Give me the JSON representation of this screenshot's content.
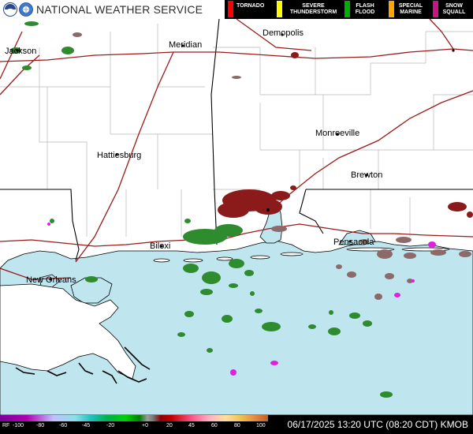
{
  "header": {
    "title": "NATIONAL WEATHER SERVICE",
    "logo_icon": "noaa-logo-icon",
    "logo2_icon": "nws-logo-icon"
  },
  "legend": {
    "items": [
      {
        "label": "TORNADO",
        "color": "#ff0000"
      },
      {
        "label": "SEVERE THUNDERSTORM",
        "color": "#ffff00"
      },
      {
        "label": "FLASH FLOOD",
        "color": "#00b000"
      },
      {
        "label": "SPECIAL MARINE",
        "color": "#ffa500"
      },
      {
        "label": "SNOW SQUALL",
        "color": "#c71585"
      }
    ]
  },
  "map": {
    "cities": [
      "Jackson",
      "Meridian",
      "Demopolis",
      "Hattiesburg",
      "Monroeville",
      "Brewton",
      "Biloxi",
      "New Orleans",
      "Pensacola"
    ],
    "water_color": "#bfe6ef",
    "land_color": "#ffffff"
  },
  "scale": {
    "label": "RF",
    "ticks": [
      "-100",
      "-80",
      "-60",
      "-45",
      "-20",
      "+0",
      "20",
      "45",
      "60",
      "80",
      "100"
    ]
  },
  "footer": {
    "timestamp": "06/17/2025 13:20 UTC (08:20 CDT)",
    "station": "KMOB"
  }
}
